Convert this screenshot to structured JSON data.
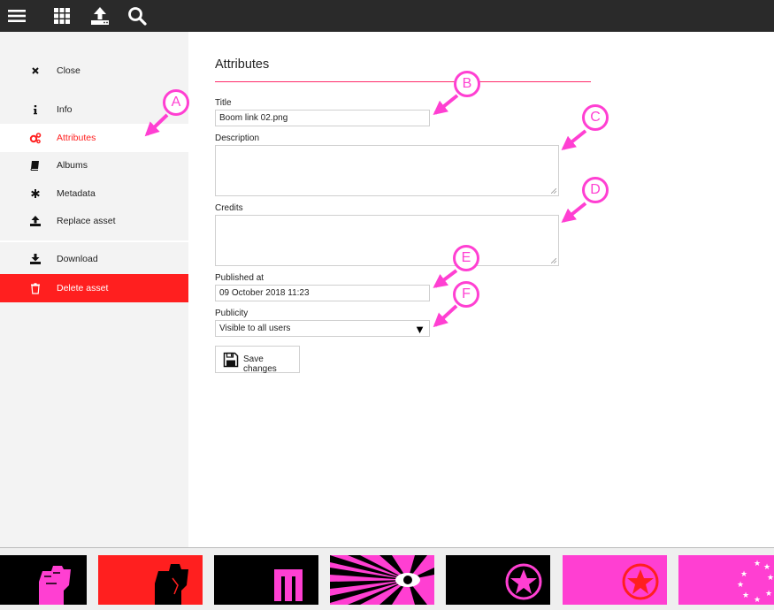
{
  "topbar": {
    "icons": [
      "menu-icon",
      "grid-icon",
      "upload-icon",
      "search-icon"
    ]
  },
  "sidebar": {
    "items": [
      {
        "label": "Close",
        "icon": "close-icon"
      },
      {
        "label": "Info",
        "icon": "info-icon"
      },
      {
        "label": "Attributes",
        "icon": "cogs-icon"
      },
      {
        "label": "Albums",
        "icon": "book-icon"
      },
      {
        "label": "Metadata",
        "icon": "asterisk-icon"
      },
      {
        "label": "Replace asset",
        "icon": "upload-icon"
      },
      {
        "label": "Download",
        "icon": "download-icon"
      },
      {
        "label": "Delete asset",
        "icon": "trash-icon"
      }
    ]
  },
  "form": {
    "heading": "Attributes",
    "title_label": "Title",
    "title_value": "Boom link 02.png",
    "description_label": "Description",
    "description_value": "",
    "credits_label": "Credits",
    "credits_value": "",
    "published_label": "Published at",
    "published_value": "09 October 2018 11:23",
    "publicity_label": "Publicity",
    "publicity_value": "Visible to all users",
    "save_label": "Save changes"
  },
  "callouts": [
    "A",
    "B",
    "C",
    "D",
    "E",
    "F"
  ],
  "colors": {
    "accent": "#ff2020",
    "callout": "#ff3fd2",
    "topbar": "#2a2a2a",
    "sidebar": "#f3f3f3"
  },
  "thumbnails": [
    {
      "name": "fist-pink-on-black"
    },
    {
      "name": "fist-black-on-red"
    },
    {
      "name": "letter-m-pink-on-black"
    },
    {
      "name": "sunburst-eye"
    },
    {
      "name": "star-circle-pink-on-black"
    },
    {
      "name": "star-circle-red-on-pink"
    },
    {
      "name": "stars-circle-on-pink"
    }
  ]
}
